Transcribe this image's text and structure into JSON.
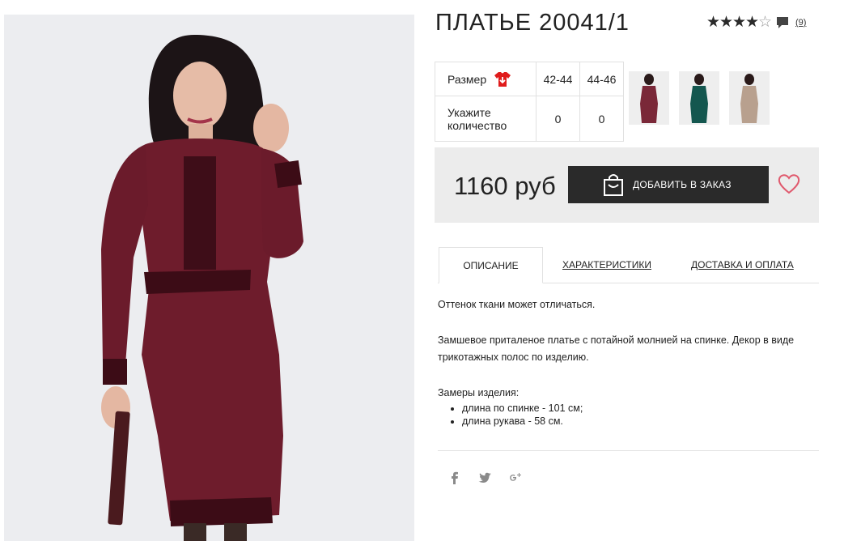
{
  "product": {
    "title": "ПЛАТЬЕ 20041/1",
    "rating": 4,
    "rating_max": 5,
    "reviews_count": "(9)"
  },
  "size_table": {
    "size_label": "Размер",
    "qty_label_line1": "Укажите",
    "qty_label_line2": "количество",
    "sizes": [
      {
        "size": "42-44",
        "qty": "0"
      },
      {
        "size": "44-46",
        "qty": "0"
      }
    ]
  },
  "thumbnails": [
    {
      "color_name": "burgundy",
      "color": "#7a2838"
    },
    {
      "color_name": "green",
      "color": "#14574f"
    },
    {
      "color_name": "beige",
      "color": "#b8a08e"
    }
  ],
  "buy": {
    "price": "1160 руб",
    "add_button_label": "ДОБАВИТЬ В ЗАКАЗ"
  },
  "tabs": [
    {
      "label": "ОПИСАНИЕ",
      "active": true
    },
    {
      "label": "ХАРАКТЕРИСТИКИ",
      "active": false
    },
    {
      "label": "ДОСТАВКА И ОПЛАТА",
      "active": false
    }
  ],
  "description": {
    "p1": "Оттенок ткани может отличаться.",
    "p2": "Замшевое приталеное платье с потайной молнией на спинке. Декор в виде трикотажных полос по изделию.",
    "measure_title": "Замеры изделия:",
    "measures": [
      "длина по спинке - 101 см;",
      "длина рукава - 58 см."
    ]
  },
  "social": [
    "facebook-icon",
    "twitter-icon",
    "google-plus-icon"
  ],
  "colors": {
    "button_bg": "#2a2a2a",
    "buy_bar_bg": "#ececec",
    "heart": "#e05a6e",
    "size_icon": "#e01b1b",
    "dress": "#6e1c2c"
  }
}
